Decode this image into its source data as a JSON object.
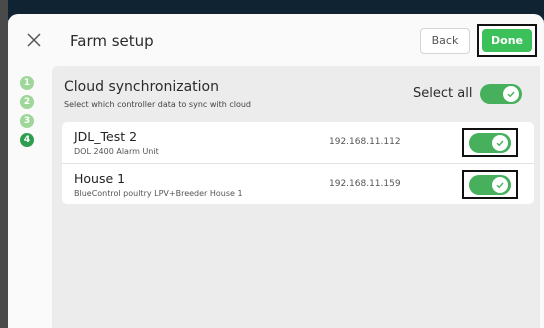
{
  "header": {
    "title": "Farm setup",
    "back_label": "Back",
    "done_label": "Done"
  },
  "steps": [
    "1",
    "2",
    "3",
    "4"
  ],
  "active_step": "4",
  "panel": {
    "title": "Cloud synchronization",
    "subtitle": "Select which controller data to sync with cloud",
    "select_all_label": "Select all",
    "select_all_on": true
  },
  "controllers": [
    {
      "name": "JDL_Test 2",
      "description": "DOL 2400 Alarm Unit",
      "ip": "192.168.11.112",
      "enabled": true
    },
    {
      "name": "House 1",
      "description": "BlueControl poultry LPV+Breeder House 1",
      "ip": "192.168.11.159",
      "enabled": true
    }
  ],
  "colors": {
    "accent_green": "#3cc05a",
    "toggle_green": "#46b05c",
    "step_done": "#9fd69a",
    "step_active": "#2e9d4f"
  },
  "icons": {
    "close": "close-icon",
    "toggle_check": "check-icon"
  }
}
